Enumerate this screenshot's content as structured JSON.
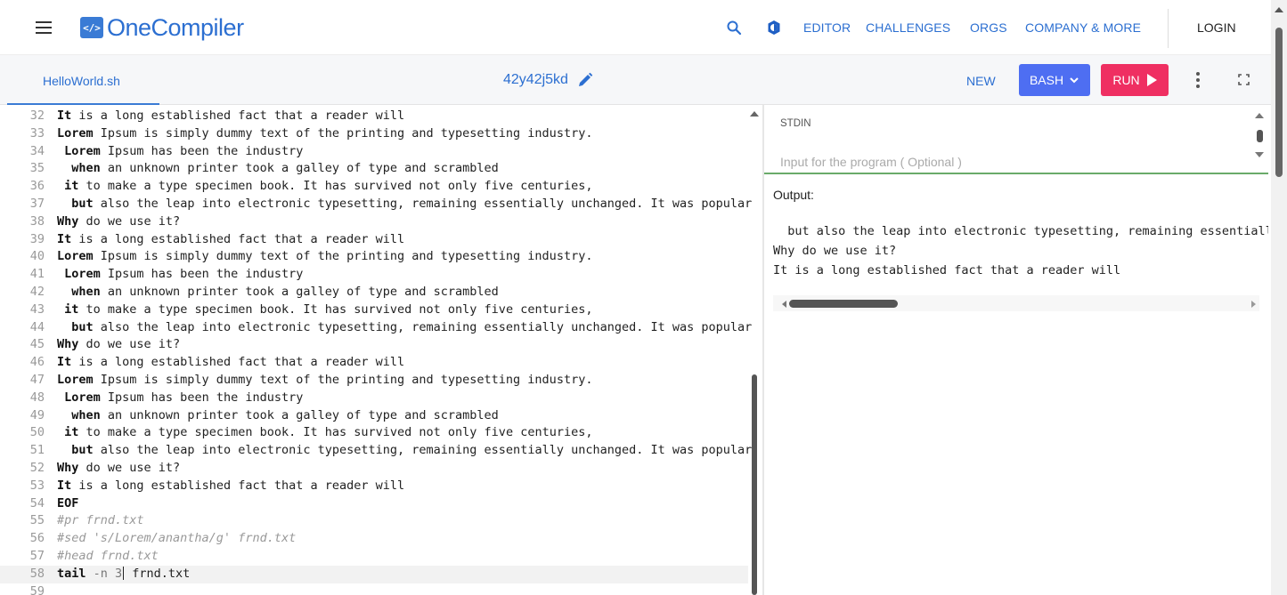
{
  "nav": {
    "brand": "OneCompiler",
    "logo_badge": "</>",
    "links": [
      "EDITOR",
      "CHALLENGES",
      "ORGS",
      "COMPANY & MORE"
    ],
    "login": "LOGIN"
  },
  "toolbar": {
    "file_tab": "HelloWorld.sh",
    "doc_id": "42y42j5kd",
    "new_label": "NEW",
    "lang_label": "BASH",
    "run_label": "RUN"
  },
  "editor": {
    "lines": [
      {
        "n": "32",
        "kw": "It",
        "rest": " is a long established fact that a reader will",
        "indent": ""
      },
      {
        "n": "33",
        "kw": "Lorem",
        "rest": " Ipsum is simply dummy text of the printing and typesetting industry.",
        "indent": ""
      },
      {
        "n": "34",
        "kw": "Lorem",
        "rest": " Ipsum has been the industry",
        "indent": " "
      },
      {
        "n": "35",
        "kw": "when",
        "rest": " an unknown printer took a galley of type and scrambled",
        "indent": "  "
      },
      {
        "n": "36",
        "kw": "it",
        "rest": " to make a type specimen book. It has survived not only five centuries,",
        "indent": " "
      },
      {
        "n": "37",
        "kw": "but",
        "rest": " also the leap into electronic typesetting, remaining essentially unchanged. It was popular",
        "indent": "  "
      },
      {
        "n": "38",
        "kw": "Why",
        "rest": " do we use it?",
        "indent": ""
      },
      {
        "n": "39",
        "kw": "It",
        "rest": " is a long established fact that a reader will",
        "indent": ""
      },
      {
        "n": "40",
        "kw": "Lorem",
        "rest": " Ipsum is simply dummy text of the printing and typesetting industry.",
        "indent": ""
      },
      {
        "n": "41",
        "kw": "Lorem",
        "rest": " Ipsum has been the industry",
        "indent": " "
      },
      {
        "n": "42",
        "kw": "when",
        "rest": " an unknown printer took a galley of type and scrambled",
        "indent": "  "
      },
      {
        "n": "43",
        "kw": "it",
        "rest": " to make a type specimen book. It has survived not only five centuries,",
        "indent": " "
      },
      {
        "n": "44",
        "kw": "but",
        "rest": " also the leap into electronic typesetting, remaining essentially unchanged. It was popular",
        "indent": "  "
      },
      {
        "n": "45",
        "kw": "Why",
        "rest": " do we use it?",
        "indent": ""
      },
      {
        "n": "46",
        "kw": "It",
        "rest": " is a long established fact that a reader will",
        "indent": ""
      },
      {
        "n": "47",
        "kw": "Lorem",
        "rest": " Ipsum is simply dummy text of the printing and typesetting industry.",
        "indent": ""
      },
      {
        "n": "48",
        "kw": "Lorem",
        "rest": " Ipsum has been the industry",
        "indent": " "
      },
      {
        "n": "49",
        "kw": "when",
        "rest": " an unknown printer took a galley of type and scrambled",
        "indent": "  "
      },
      {
        "n": "50",
        "kw": "it",
        "rest": " to make a type specimen book. It has survived not only five centuries,",
        "indent": " "
      },
      {
        "n": "51",
        "kw": "but",
        "rest": " also the leap into electronic typesetting, remaining essentially unchanged. It was popular",
        "indent": "  "
      },
      {
        "n": "52",
        "kw": "Why",
        "rest": " do we use it?",
        "indent": ""
      },
      {
        "n": "53",
        "kw": "It",
        "rest": " is a long established fact that a reader will",
        "indent": ""
      },
      {
        "n": "54",
        "kw": "EOF",
        "rest": "",
        "indent": ""
      },
      {
        "n": "55",
        "cm": "#pr frnd.txt"
      },
      {
        "n": "56",
        "cm": "#sed 's/Lorem/anantha/g' frnd.txt"
      },
      {
        "n": "57",
        "cm": "#head frnd.txt"
      },
      {
        "n": "58",
        "kw": "tail",
        "flag": " -n 3",
        "rest": " frnd.txt",
        "active": true
      },
      {
        "n": "59",
        "kw": "",
        "rest": "",
        "indent": ""
      }
    ]
  },
  "stdin": {
    "label": "STDIN",
    "placeholder": "Input for the program ( Optional )"
  },
  "output": {
    "label": "Output:",
    "lines": [
      "  but also the leap into electronic typesetting, remaining essentially unchanged. It was popular",
      "Why do we use it?",
      "It is a long established fact that a reader will"
    ]
  },
  "colors": {
    "brand": "#2c6fd1",
    "bash_button": "#4e6ef2",
    "run_button": "#ef2f62",
    "stdin_underline": "#6aab6a"
  },
  "icons": [
    "hamburger-icon",
    "search-icon",
    "theme-toggle-icon",
    "pencil-icon",
    "chevron-down-icon",
    "play-icon",
    "kebab-menu-icon",
    "fullscreen-icon"
  ]
}
